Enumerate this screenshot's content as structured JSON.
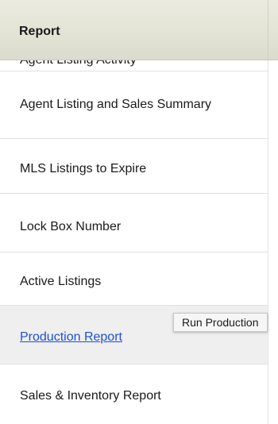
{
  "header": {
    "title": "Report"
  },
  "reports": {
    "items": [
      {
        "label": "Agent Listing Activity"
      },
      {
        "label": "Agent Listing and Sales Summary"
      },
      {
        "label": "MLS Listings to Expire"
      },
      {
        "label": "Lock Box Number"
      },
      {
        "label": "Active Listings"
      },
      {
        "label": "Production Report",
        "link": true,
        "hovered": true
      },
      {
        "label": "Sales & Inventory Report"
      }
    ]
  },
  "tooltip": {
    "text": "Run Production"
  },
  "colors": {
    "header_background": "#e4e4d6",
    "link": "#1f4fd6",
    "hover_row": "#efefef",
    "text": "#1a1a1a"
  }
}
